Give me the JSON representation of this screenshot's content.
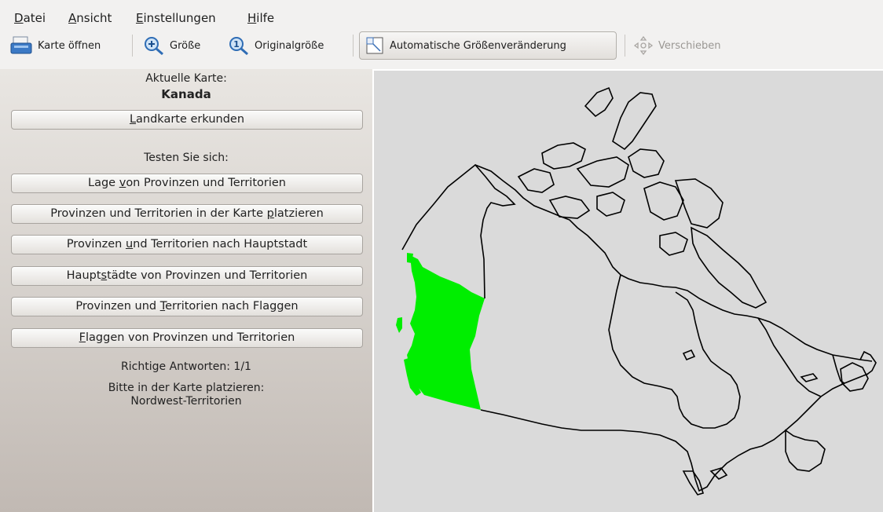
{
  "menubar": {
    "items": [
      {
        "mnemonic": "D",
        "rest": "atei"
      },
      {
        "mnemonic": "A",
        "rest": "nsicht"
      },
      {
        "mnemonic": "E",
        "rest": "instellungen"
      },
      {
        "mnemonic": "H",
        "rest": "ilfe"
      }
    ]
  },
  "toolbar": {
    "open_map": {
      "label": "Karte öffnen",
      "icon": "open-map-icon"
    },
    "zoom": {
      "label": "Größe",
      "icon": "zoom-in-icon"
    },
    "original": {
      "label": "Originalgröße",
      "icon": "original-size-icon"
    },
    "auto_resize": {
      "label": "Automatische Größenveränderung",
      "icon": "auto-resize-icon",
      "active": true
    },
    "move": {
      "label": "Verschieben",
      "icon": "move-icon",
      "enabled": false
    }
  },
  "panel": {
    "current_map_label": "Aktuelle Karte:",
    "current_map_name": "Kanada",
    "explore_button": {
      "mnemonic": "L",
      "rest": "andkarte erkunden"
    },
    "test_label": "Testen Sie sich:",
    "quiz_buttons": [
      {
        "before": "Lage ",
        "mnemonic": "v",
        "after": "on Provinzen und Territorien"
      },
      {
        "before": "Provinzen und Territorien in der Karte ",
        "mnemonic": "p",
        "after": "latzieren"
      },
      {
        "before": "Provinzen ",
        "mnemonic": "u",
        "after": "nd Territorien nach Hauptstadt"
      },
      {
        "before": "Haupt",
        "mnemonic": "s",
        "after": "tädte von Provinzen und Territorien"
      },
      {
        "before": "Provinzen und ",
        "mnemonic": "T",
        "after": "erritorien nach Flaggen"
      },
      {
        "before": "",
        "mnemonic": "F",
        "after": "laggen von Provinzen und Territorien"
      }
    ],
    "score_text": "Richtige Antworten: 1/1",
    "instruction_text": "Bitte in der Karte platzieren:",
    "target_region": "Nordwest-Territorien"
  },
  "map": {
    "placed_region_color": "#00ee00",
    "outline_color": "#000000",
    "background_color": "#dadada"
  }
}
